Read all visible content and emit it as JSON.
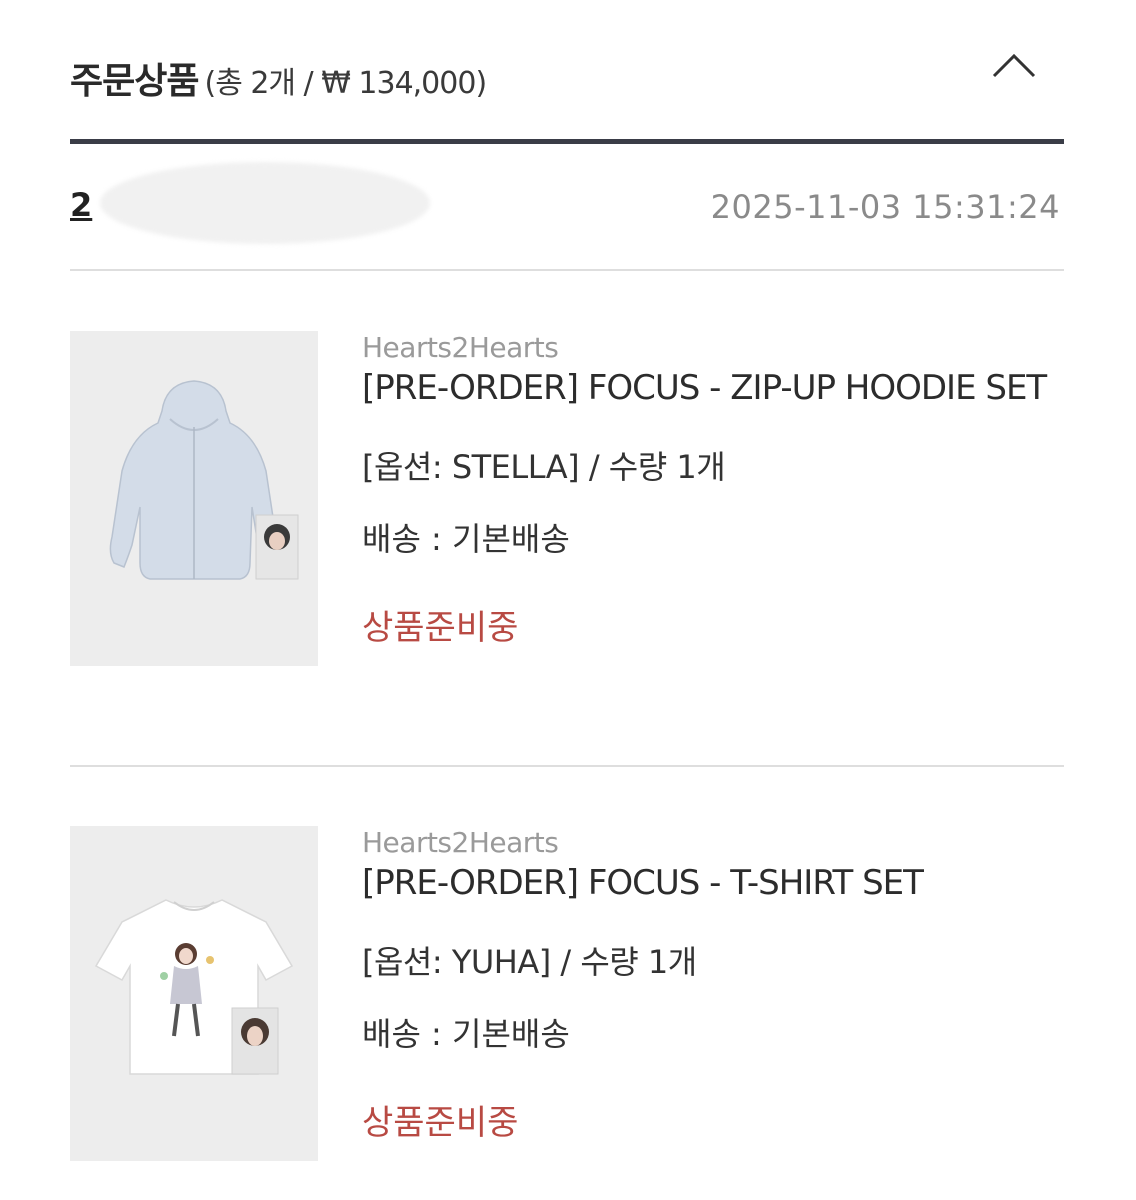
{
  "header": {
    "title": "주문상품",
    "summary": "(총 2개 / ₩ 134,000)",
    "collapse_icon": "chevron-up-icon"
  },
  "order": {
    "number_visible": "2",
    "date": "2025-11-03 15:31:24"
  },
  "items": [
    {
      "brand": "Hearts2Hearts",
      "name": "[PRE-ORDER] FOCUS - ZIP-UP HOODIE SET",
      "option": "[옵션: STELLA] / 수량 1개",
      "shipping": "배송 : 기본배송",
      "status": "상품준비중",
      "image": "zip-up-hoodie-with-photocard"
    },
    {
      "brand": "Hearts2Hearts",
      "name": "[PRE-ORDER] FOCUS - T-SHIRT SET",
      "option": "[옵션: YUHA] / 수량 1개",
      "shipping": "배송 : 기본배송",
      "status": "상품준비중",
      "image": "t-shirt-with-photocard"
    }
  ],
  "colors": {
    "status": "#b84a43",
    "divider_dark": "#3a3d47",
    "divider_light": "#dedede"
  }
}
